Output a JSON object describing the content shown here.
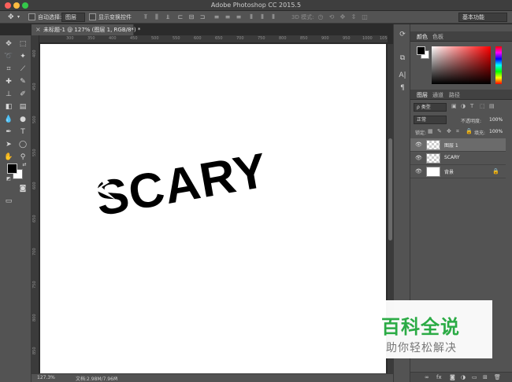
{
  "app": {
    "title": "Adobe Photoshop CC 2015.5"
  },
  "options_bar": {
    "auto_select_label": "自动选择:",
    "auto_select_value": "图层",
    "show_transform_label": "显示变换控件",
    "mode_3d": "3D 模式:",
    "workspace": "基本功能"
  },
  "document": {
    "tab_title": "未标题-1 @ 127% (图层 1, RGB/8*) *",
    "canvas_text": "SCARY",
    "text_color": "#000000",
    "canvas_color": "#ffffff"
  },
  "rulers": {
    "horizontal": [
      "300",
      "350",
      "400",
      "450",
      "500",
      "550",
      "600",
      "650",
      "700",
      "750",
      "800",
      "850",
      "900",
      "950",
      "1000",
      "1050"
    ],
    "vertical": [
      "400",
      "450",
      "500",
      "550",
      "600",
      "650",
      "700",
      "750",
      "800",
      "850"
    ]
  },
  "status": {
    "zoom": "127.3%",
    "doc_size": "文档:2.98M/7.96M"
  },
  "color_panel": {
    "tabs": [
      "颜色",
      "色板"
    ],
    "foreground": "#000000",
    "background": "#ffffff"
  },
  "layers_panel": {
    "tabs": [
      "图层",
      "通道",
      "路径"
    ],
    "filter_kind": "ρ 类型",
    "blend_mode": "正常",
    "opacity_label": "不透明度:",
    "opacity_value": "100%",
    "lock_label": "锁定:",
    "fill_label": "填充:",
    "fill_value": "100%",
    "layers": [
      {
        "name": "图层 1",
        "thumb": "transparent",
        "selected": true,
        "locked": false
      },
      {
        "name": "SCARY",
        "thumb": "transparent",
        "selected": false,
        "locked": false
      },
      {
        "name": "背景",
        "thumb": "white",
        "selected": false,
        "locked": true
      }
    ],
    "bottom_icons": [
      "link-icon",
      "fx-icon",
      "mask-icon",
      "adjustment-icon",
      "group-icon",
      "new-layer-icon",
      "trash-icon"
    ]
  },
  "watermark": {
    "title": "百科全说",
    "subtitle": "助你轻松解决",
    "color": "#2bab45"
  }
}
